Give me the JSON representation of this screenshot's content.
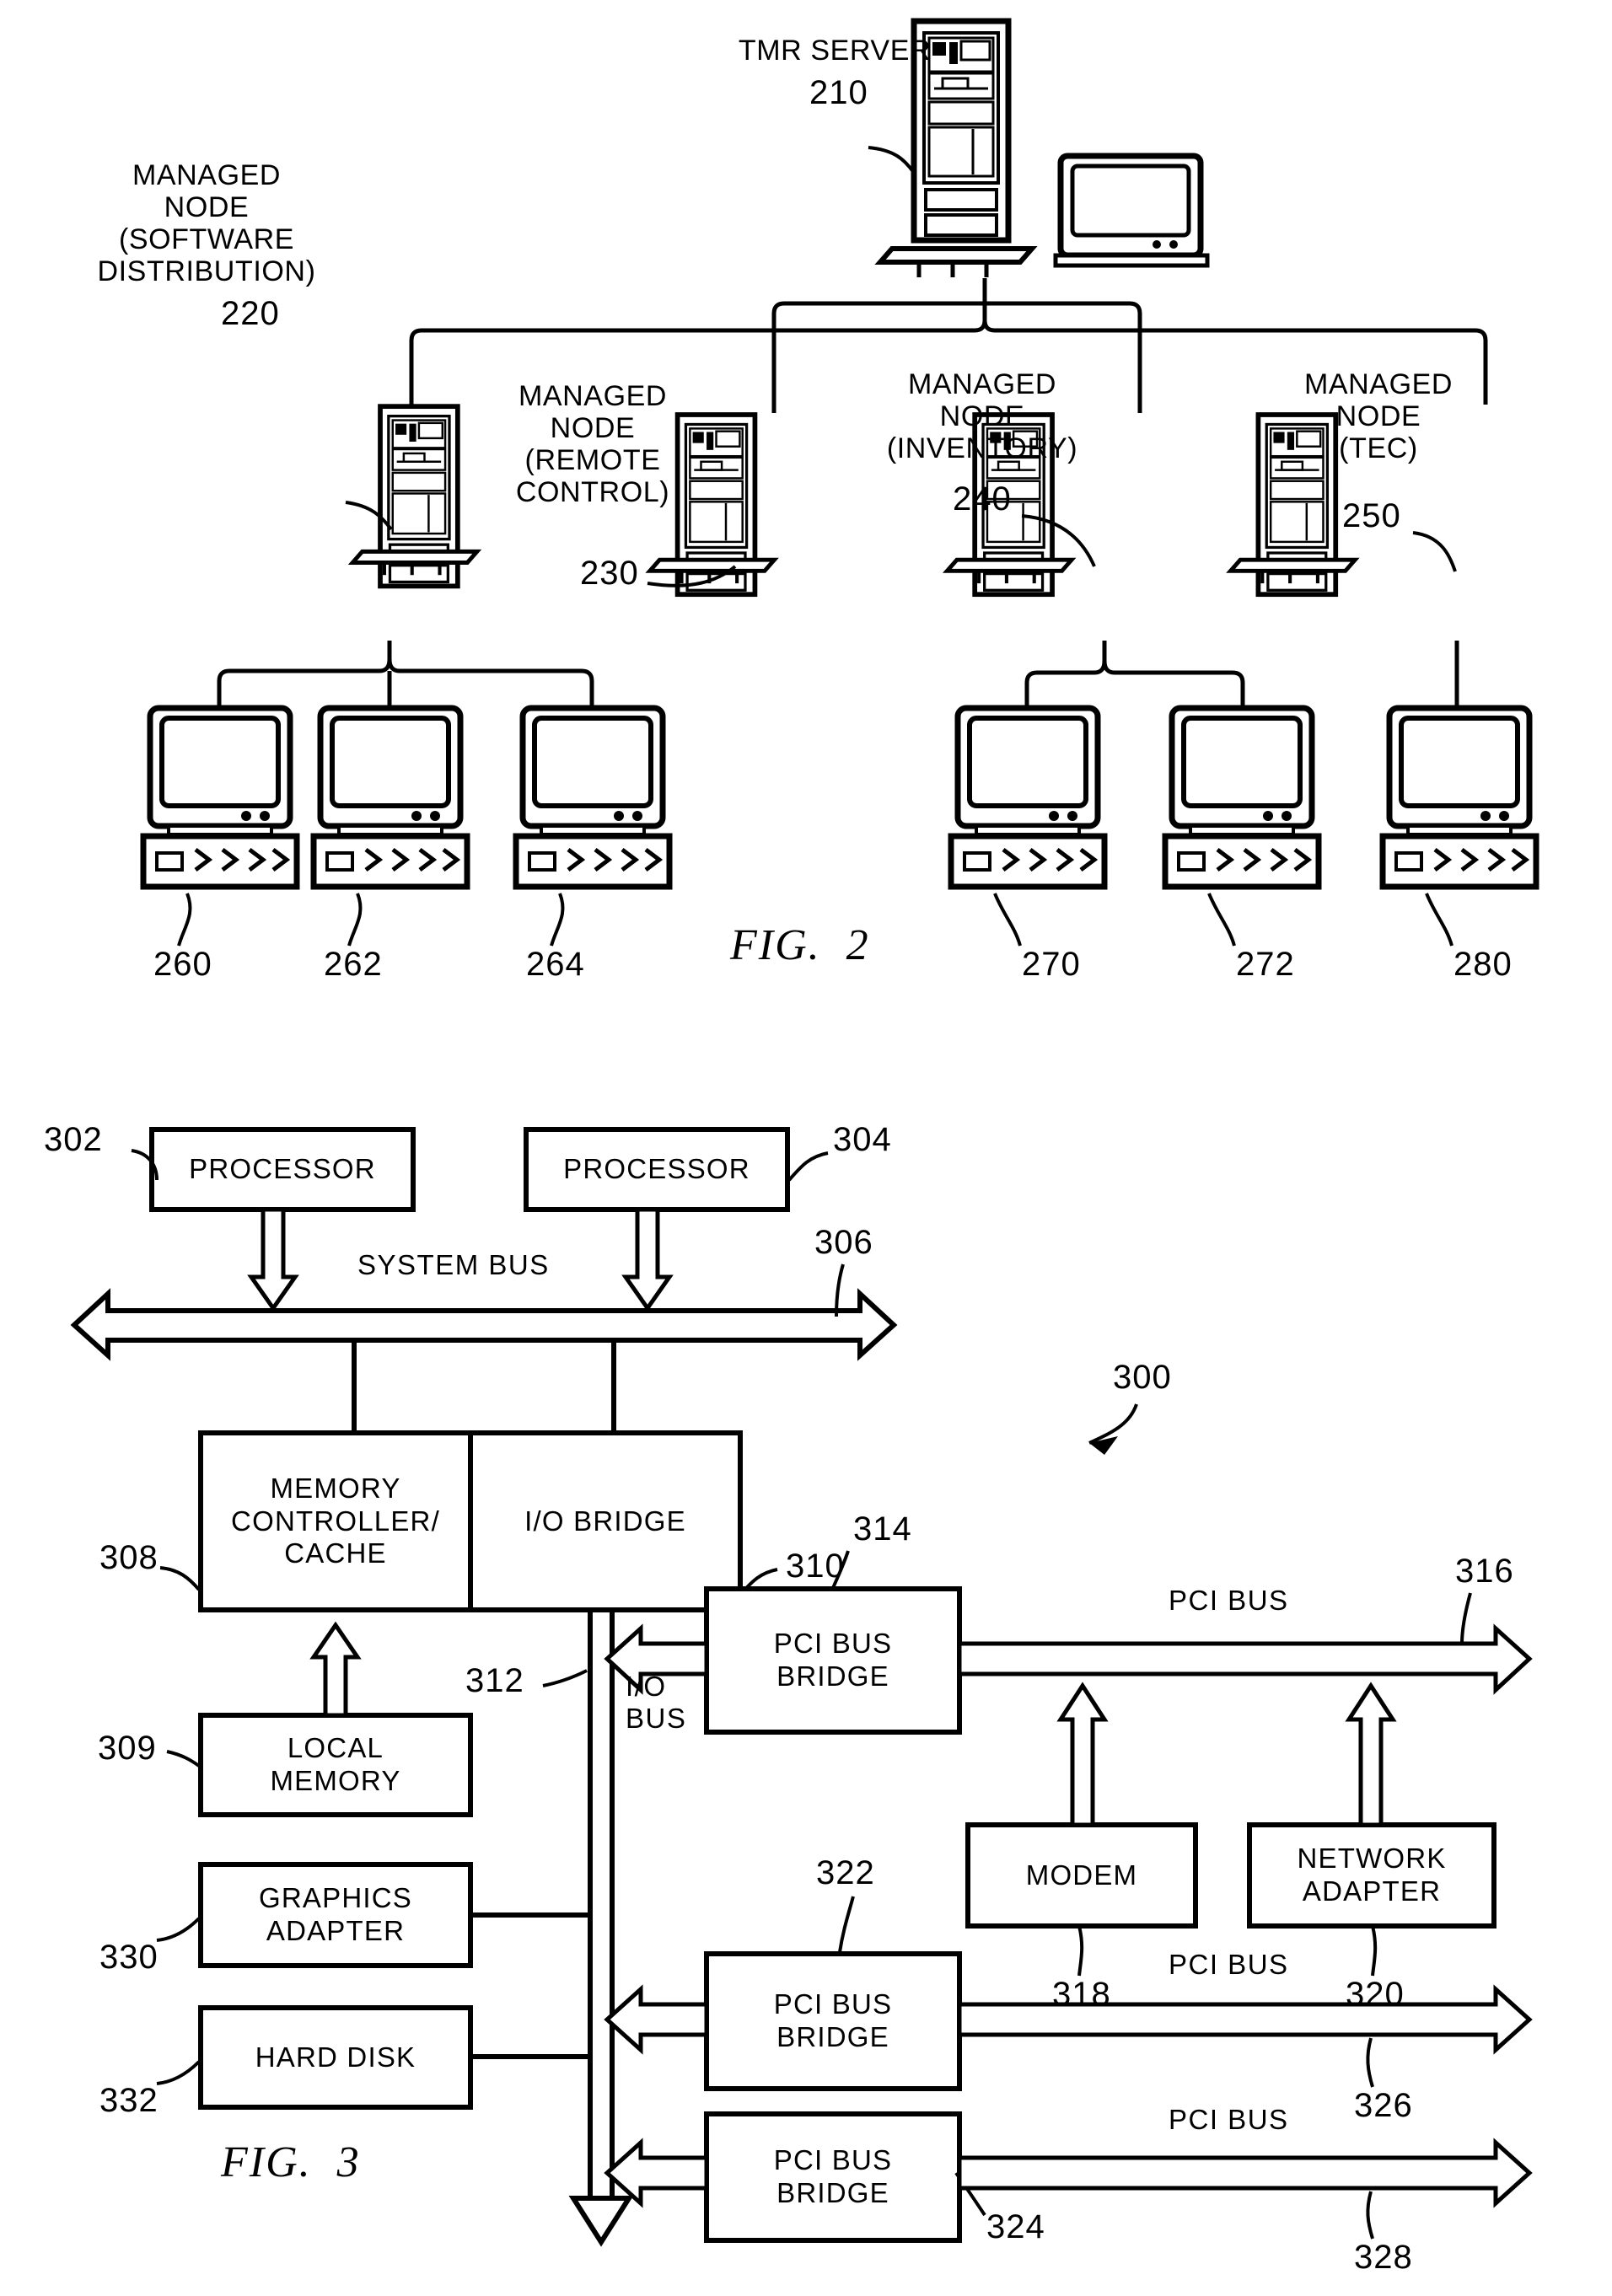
{
  "figure2": {
    "caption": "FIG.  2",
    "server": {
      "label": "TMR SERVER",
      "ref": "210"
    },
    "managed_nodes": [
      {
        "line1": "MANAGED",
        "line2": "NODE",
        "line3": "(SOFTWARE",
        "line4": "DISTRIBUTION)",
        "ref": "220"
      },
      {
        "line1": "MANAGED",
        "line2": "NODE",
        "line3": "(REMOTE",
        "line4": "CONTROL)",
        "ref": "230"
      },
      {
        "line1": "MANAGED",
        "line2": "NODE",
        "line3": "(INVENTORY)",
        "line4": "",
        "ref": "240"
      },
      {
        "line1": "MANAGED",
        "line2": "NODE",
        "line3": "(TEC)",
        "line4": "",
        "ref": "250"
      }
    ],
    "workstation_refs": [
      "260",
      "262",
      "264",
      "270",
      "272",
      "280"
    ]
  },
  "figure3": {
    "caption": "FIG.  3",
    "system_ref": "300",
    "blocks": [
      {
        "id": "processor1",
        "text": "PROCESSOR",
        "ref": "302"
      },
      {
        "id": "processor2",
        "text": "PROCESSOR",
        "ref": "304"
      },
      {
        "id": "memory_controller",
        "text": "MEMORY\nCONTROLLER/\nCACHE",
        "ref": "308"
      },
      {
        "id": "io_bridge",
        "text": "I/O BRIDGE",
        "ref": "310"
      },
      {
        "id": "local_memory",
        "text": "LOCAL\nMEMORY",
        "ref": "309"
      },
      {
        "id": "pci_bus_bridge_1",
        "text": "PCI BUS\nBRIDGE",
        "ref": "314"
      },
      {
        "id": "modem",
        "text": "MODEM",
        "ref": "318"
      },
      {
        "id": "network_adapter",
        "text": "NETWORK\nADAPTER",
        "ref": "320"
      },
      {
        "id": "graphics_adapter",
        "text": "GRAPHICS\nADAPTER",
        "ref": "330"
      },
      {
        "id": "hard_disk",
        "text": "HARD DISK",
        "ref": "332"
      },
      {
        "id": "pci_bus_bridge_2",
        "text": "PCI BUS\nBRIDGE",
        "ref": "322"
      },
      {
        "id": "pci_bus_bridge_3",
        "text": "PCI BUS\nBRIDGE",
        "ref": "324"
      }
    ],
    "buses": [
      {
        "id": "system_bus",
        "label": "SYSTEM BUS",
        "ref": "306"
      },
      {
        "id": "io_bus",
        "label": "I/O\nBUS",
        "ref": "312"
      },
      {
        "id": "pci_bus_1",
        "label": "PCI BUS",
        "ref": "316"
      },
      {
        "id": "pci_bus_2",
        "label": "PCI BUS",
        "ref": "326"
      },
      {
        "id": "pci_bus_3",
        "label": "PCI BUS",
        "ref": "328"
      }
    ]
  },
  "colors": {
    "ink": "#000000",
    "paper": "#ffffff"
  }
}
